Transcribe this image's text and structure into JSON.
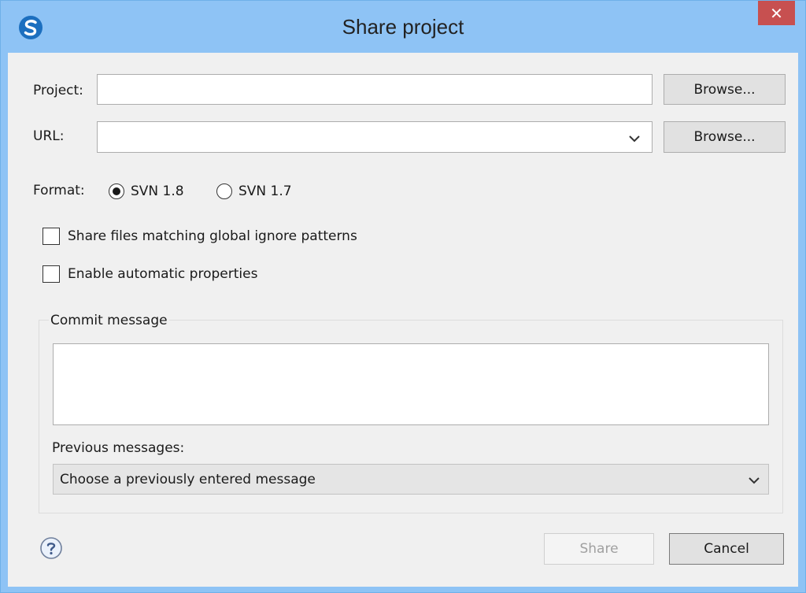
{
  "window": {
    "title": "Share project",
    "close_label": "✕",
    "app_icon": "svn-logo-icon",
    "accent_color": "#8ec3f5"
  },
  "project": {
    "label": "Project:",
    "value": "",
    "browse_label": "Browse..."
  },
  "url": {
    "label": "URL:",
    "value": "",
    "browse_label": "Browse..."
  },
  "format": {
    "label": "Format:",
    "options": [
      {
        "label": "SVN 1.8",
        "selected": true
      },
      {
        "label": "SVN 1.7",
        "selected": false
      }
    ]
  },
  "options": {
    "share_ignored_label": "Share files matching global ignore patterns",
    "share_ignored_checked": false,
    "auto_props_label": "Enable automatic properties",
    "auto_props_checked": false
  },
  "commit": {
    "group_title": "Commit message",
    "message": "",
    "previous_label": "Previous messages:",
    "previous_selected": "Choose a previously entered message"
  },
  "footer": {
    "help_icon": "help-icon",
    "share_label": "Share",
    "share_enabled": false,
    "cancel_label": "Cancel"
  }
}
